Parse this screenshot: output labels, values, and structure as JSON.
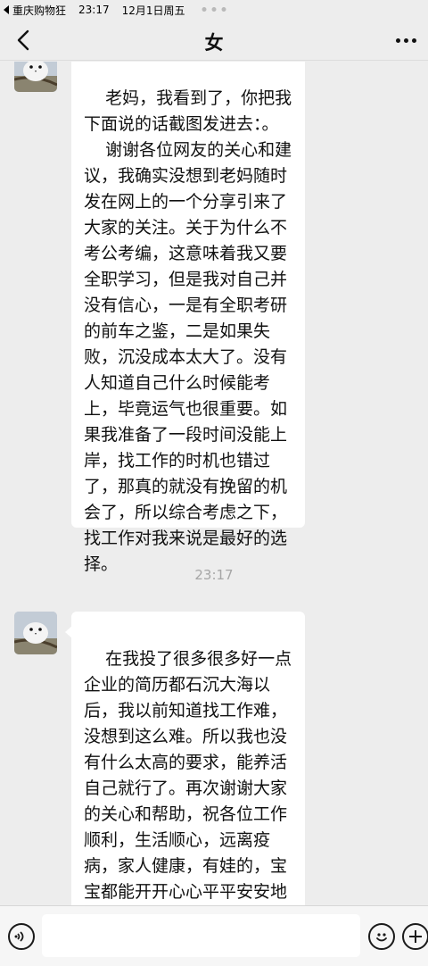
{
  "status_bar": {
    "back_app": "重庆购物狂",
    "time": "23:17",
    "date": "12月1日周五"
  },
  "header": {
    "title": "女",
    "back_icon": "chevron-left-icon",
    "more_icon": "more-dots-icon"
  },
  "messages": [
    {
      "sender": "女",
      "text": "老妈，我看到了，你把我下面说的话截图发进去：。\n    谢谢各位网友的关心和建议，我确实没想到老妈随时发在网上的一个分享引来了大家的关注。关于为什么不考公考编，这意味着我又要全职学习，但是我对自己并没有信心，一是有全职考研的前车之鉴，二是如果失败，沉没成本太大了。没有人知道自己什么时候能考上，毕竟运气也很重要。如果我准备了一段时间没能上岸，找工作的时机也错过了，那真的就没有挽留的机会了，所以综合考虑之下，找工作对我来说是最好的选择。"
    },
    {
      "sender": "女",
      "text": "在我投了很多很多好一点企业的简历都石沉大海以后，我以前知道找工作难，没想到这么难。所以我也没有什么太高的要求，能养活自己就行了。再次谢谢大家的关心和帮助，祝各位工作顺利，生活顺心，远离疫病，家人健康，有娃的，宝宝都能开开心心平平安安地长大。也祝我自己找一份好工作！"
    }
  ],
  "timestamp": "23:17",
  "input_bar": {
    "voice_icon": "voice-icon",
    "emoji_icon": "emoji-icon",
    "plus_icon": "plus-icon",
    "message_value": ""
  },
  "colors": {
    "background": "#ededed",
    "bubble": "#ffffff",
    "timestamp": "#a6a6a6"
  }
}
